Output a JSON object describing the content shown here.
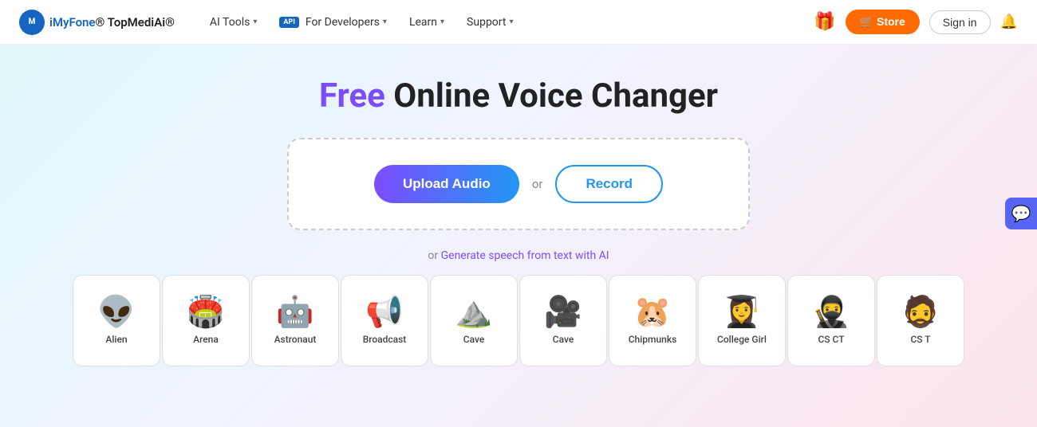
{
  "header": {
    "logo_text": "iMyFone",
    "logo_sub": "TopMedi",
    "logo_ai": "Ai",
    "logo_reg": "®",
    "nav": [
      {
        "label": "AI Tools",
        "chevron": true
      },
      {
        "label": "For Developers",
        "chevron": true,
        "badge": "API"
      },
      {
        "label": "Learn",
        "chevron": true
      },
      {
        "label": "Support",
        "chevron": true
      }
    ],
    "store_label": "🛒 Store",
    "signin_label": "Sign in"
  },
  "hero": {
    "title_free": "Free",
    "title_rest": " Online Voice Changer",
    "upload_label": "Upload Audio",
    "or_label": "or",
    "record_label": "Record",
    "generate_text": "or ",
    "generate_link": "Generate speech from text with AI"
  },
  "voice_cards": [
    {
      "label": "Alien",
      "emoji": "👽"
    },
    {
      "label": "Arena",
      "emoji": "🏟️"
    },
    {
      "label": "Astronaut",
      "emoji": "🤖"
    },
    {
      "label": "Broadcast",
      "emoji": "📢"
    },
    {
      "label": "Cave",
      "emoji": "⛰️"
    },
    {
      "label": "Cave",
      "emoji": "🎥"
    },
    {
      "label": "Chipmunks",
      "emoji": "🐹"
    },
    {
      "label": "College Girl",
      "emoji": "👩‍🎓"
    },
    {
      "label": "CS CT",
      "emoji": "🥷"
    },
    {
      "label": "CS T",
      "emoji": "🧔"
    }
  ],
  "discord": {
    "label": "💬"
  }
}
